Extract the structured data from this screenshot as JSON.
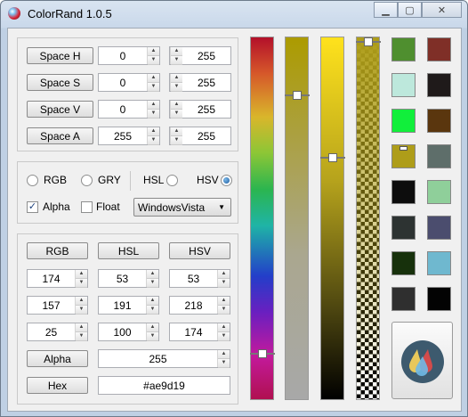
{
  "window": {
    "title": "ColorRand 1.0.5"
  },
  "ranges": [
    {
      "label": "Space H",
      "min": "0",
      "max": "255"
    },
    {
      "label": "Space S",
      "min": "0",
      "max": "255"
    },
    {
      "label": "Space V",
      "min": "0",
      "max": "255"
    },
    {
      "label": "Space A",
      "min": "255",
      "max": "255"
    }
  ],
  "modes": {
    "rgb": "RGB",
    "gry": "GRY",
    "hsl": "HSL",
    "hsv": "HSV",
    "selected": "HSV",
    "alpha_label": "Alpha",
    "alpha_checked": true,
    "float_label": "Float",
    "float_checked": false,
    "style_value": "WindowsVista"
  },
  "values": {
    "headers": [
      "RGB",
      "HSL",
      "HSV"
    ],
    "rows": [
      [
        "174",
        "53",
        "53"
      ],
      [
        "157",
        "191",
        "218"
      ],
      [
        "25",
        "100",
        "174"
      ]
    ],
    "alpha_label": "Alpha",
    "alpha_value": "255",
    "hex_label": "Hex",
    "hex_value": "#ae9d19"
  },
  "sliders": {
    "hue_level": 0.87,
    "sat_level": 0.16,
    "val_level": 0.33,
    "alpha_level": 0.0
  },
  "swatches": [
    "#4f8f2f",
    "#7f2f27",
    "#bde8dc",
    "#1f1a1a",
    "#11ef3b",
    "#5a360e",
    "#ae9d19",
    "#5e6e6a",
    "#0d0d0d",
    "#8fcf9a",
    "#2d3332",
    "#4b4d6e",
    "#17310c",
    "#6fb8cf",
    "#2f2f2f",
    "#030303"
  ],
  "colors": {
    "current": "#ae9d19"
  }
}
